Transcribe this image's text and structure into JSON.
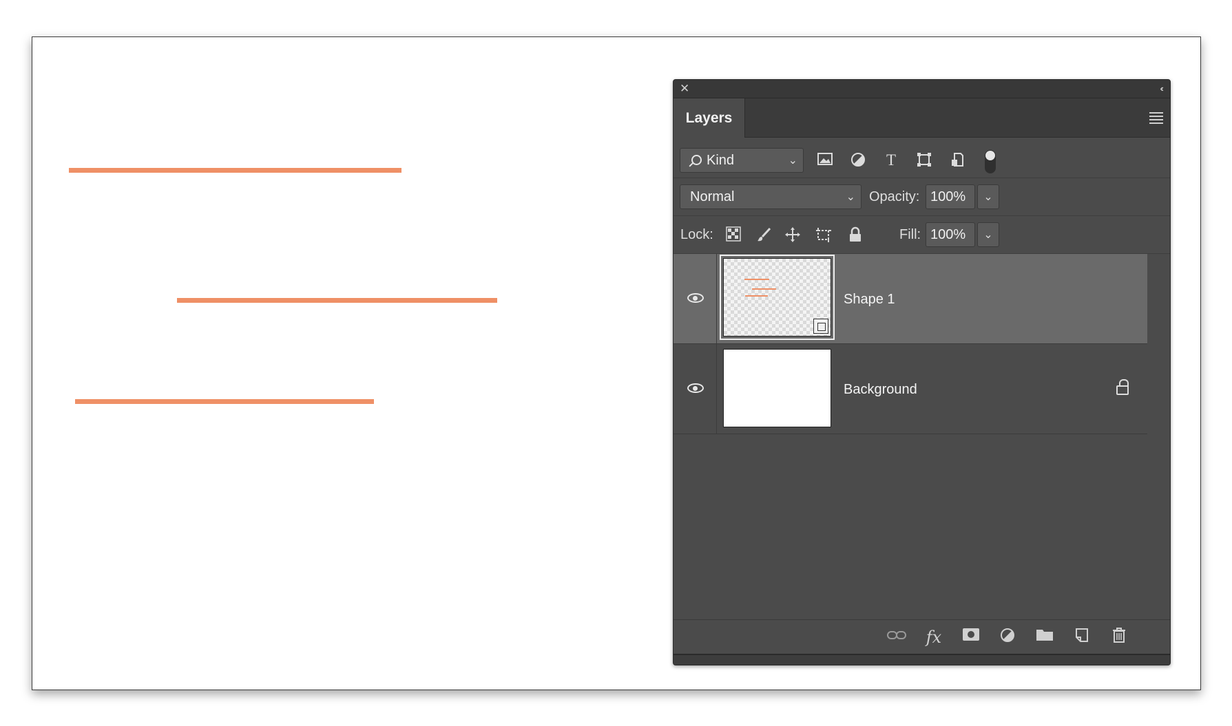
{
  "canvas": {
    "line_color": "#ef9066"
  },
  "panel": {
    "tab_label": "Layers",
    "filter": {
      "kind_label": "Kind",
      "icons": [
        "image-filter-icon",
        "adjustment-filter-icon",
        "type-filter-icon",
        "shape-filter-icon",
        "smart-object-filter-icon"
      ]
    },
    "blend": {
      "mode": "Normal",
      "opacity_label": "Opacity:",
      "opacity_value": "100%"
    },
    "lock": {
      "label": "Lock:",
      "fill_label": "Fill:",
      "fill_value": "100%"
    },
    "layers": [
      {
        "name": "Shape 1",
        "selected": true,
        "visible": true
      },
      {
        "name": "Background",
        "selected": false,
        "visible": true,
        "locked": true
      }
    ],
    "bottom_icons": [
      "link-layers-icon",
      "fx-icon",
      "add-mask-icon",
      "adjustment-layer-icon",
      "new-group-icon",
      "new-layer-icon",
      "delete-layer-icon"
    ],
    "colors": {
      "panel_bg": "#4b4b4b",
      "selected_row": "#6a6a6a",
      "accent_line": "#ef9066"
    }
  }
}
